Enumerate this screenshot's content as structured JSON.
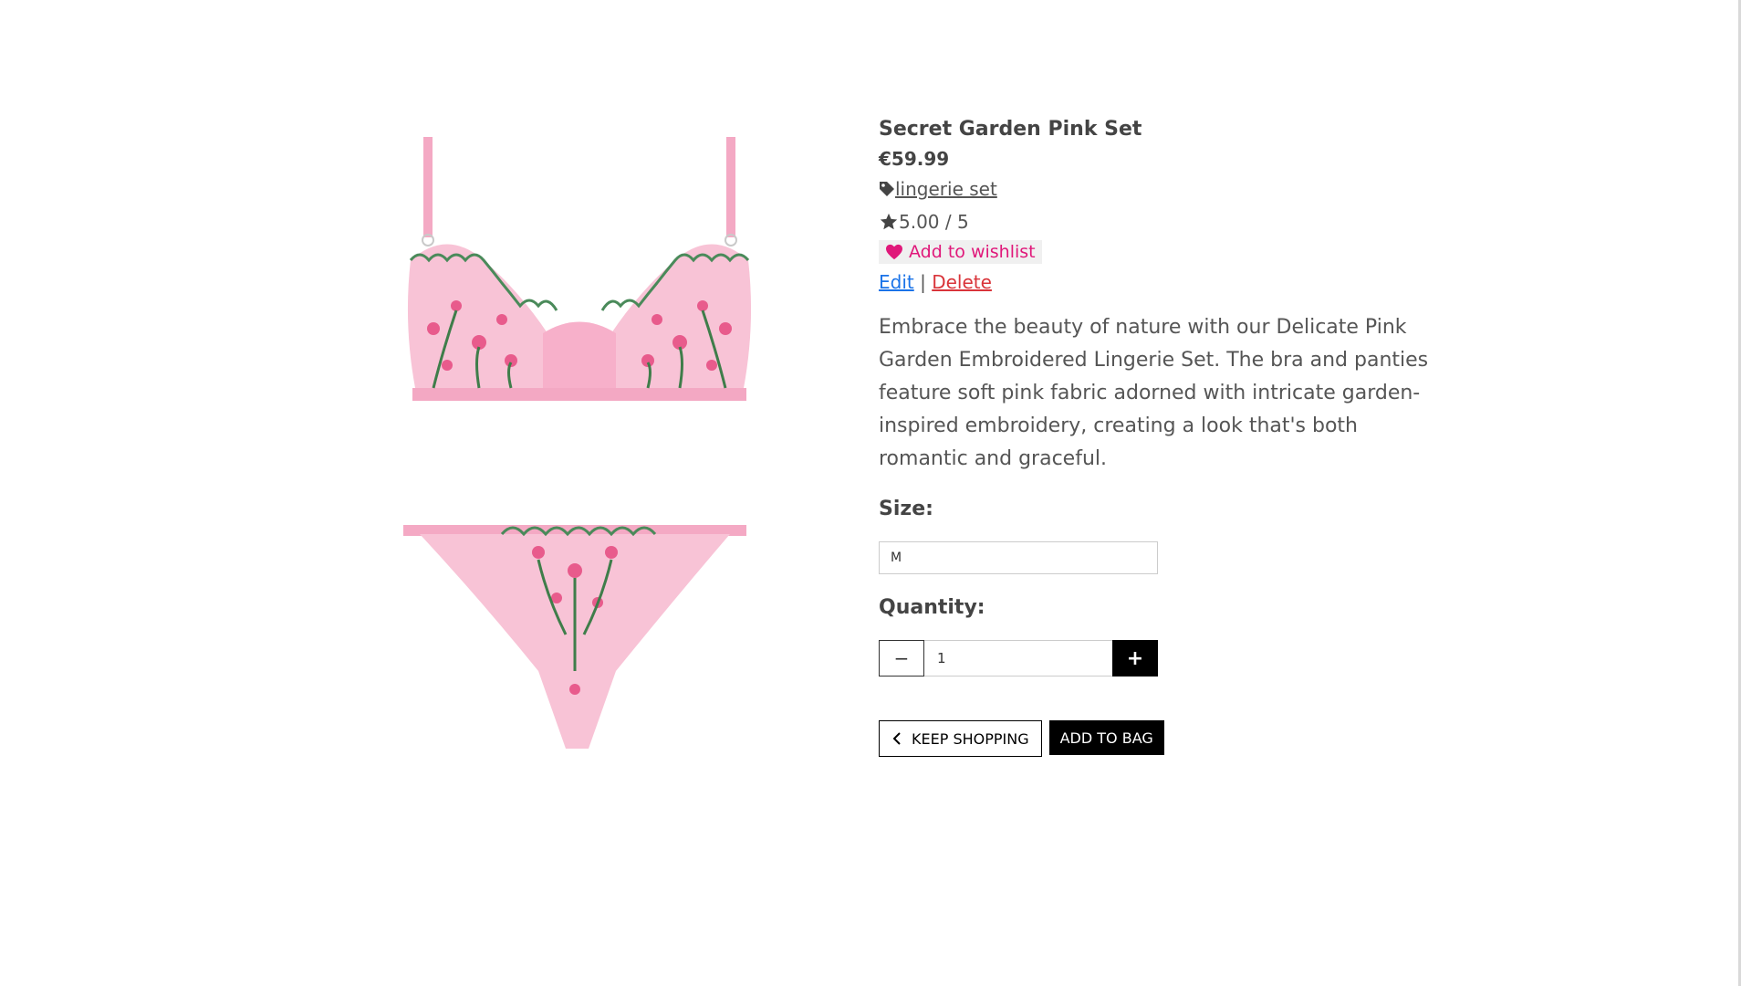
{
  "product": {
    "title": "Secret Garden Pink Set",
    "price": "€59.99",
    "category": "lingerie set",
    "rating": "5.00 / 5",
    "wishlist_label": "Add to wishlist",
    "edit_label": "Edit",
    "separator": "|",
    "delete_label": "Delete",
    "description": "Embrace the beauty of nature with our Delicate Pink Garden Embroidered Lingerie Set. The bra and panties feature soft pink fabric adorned with intricate garden-inspired embroidery, creating a look that's both romantic and graceful."
  },
  "size": {
    "label": "Size:",
    "selected": "M"
  },
  "quantity": {
    "label": "Quantity:",
    "value": "1",
    "minus": "−",
    "plus": "+"
  },
  "buttons": {
    "keep_shopping": "KEEP SHOPPING",
    "add_to_bag": "ADD TO BAG"
  },
  "icons": {
    "tag": "tag-icon",
    "star": "star-icon",
    "heart": "heart-icon",
    "chevron": "chevron-left-icon"
  },
  "colors": {
    "wishlist": "#e0187a",
    "edit": "#1a73e8",
    "delete": "#d9343a",
    "fabric": "#f7b8cf"
  }
}
